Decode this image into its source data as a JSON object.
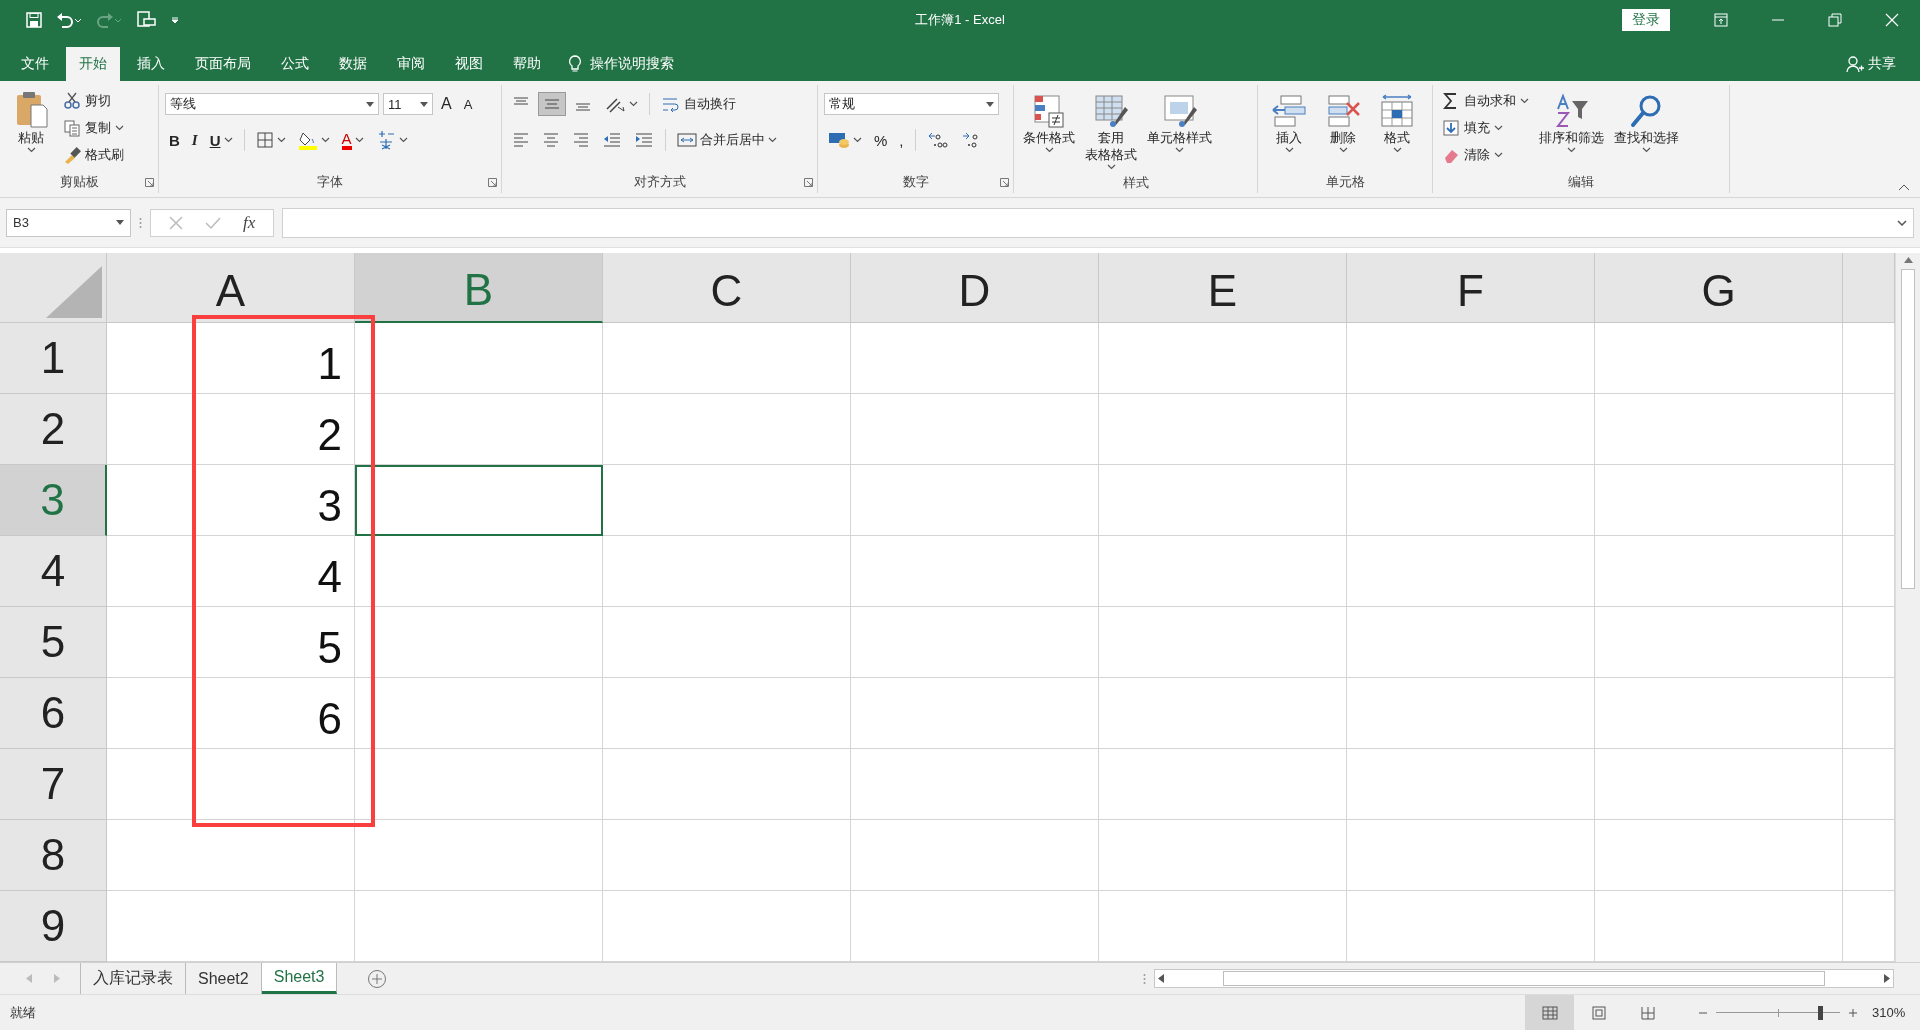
{
  "window": {
    "title": "工作簿1  -  Excel",
    "sign_in": "登录"
  },
  "ribbon_tabs": [
    {
      "label": "文件",
      "selected": false
    },
    {
      "label": "开始",
      "selected": true
    },
    {
      "label": "插入",
      "selected": false
    },
    {
      "label": "页面布局",
      "selected": false
    },
    {
      "label": "公式",
      "selected": false
    },
    {
      "label": "数据",
      "selected": false
    },
    {
      "label": "审阅",
      "selected": false
    },
    {
      "label": "视图",
      "selected": false
    },
    {
      "label": "帮助",
      "selected": false
    }
  ],
  "tell_me": "操作说明搜索",
  "share": "共享",
  "ribbon_groups": [
    {
      "label": "剪贴板",
      "launcher": true,
      "parts": [
        {
          "kind": "large",
          "label": [
            "粘贴"
          ],
          "caret": true
        },
        {
          "kind": "stack",
          "items": [
            {
              "label": "剪切"
            },
            {
              "label": "复制",
              "caret": true
            },
            {
              "label": "格式刷"
            }
          ]
        }
      ]
    },
    {
      "label": "字体",
      "launcher": true,
      "parts": [
        {
          "kind": "lines",
          "lines": [
            {
              "controls": [
                {
                  "kind": "font-combo",
                  "value": "等线"
                },
                {
                  "kind": "size-combo",
                  "value": "11"
                },
                {
                  "kind": "grow",
                  "text": "A"
                },
                {
                  "kind": "shrink",
                  "text": "A"
                }
              ]
            },
            {
              "controls": [
                {
                  "kind": "bold",
                  "text": "B"
                },
                {
                  "kind": "italic",
                  "text": "I"
                },
                {
                  "kind": "underline",
                  "text": "U",
                  "caret": true
                },
                {
                  "kind": "sep"
                },
                {
                  "kind": "borders",
                  "caret": true
                },
                {
                  "kind": "fill-color",
                  "caret": true
                },
                {
                  "kind": "font-color",
                  "text": "A",
                  "caret": true
                },
                {
                  "kind": "phonetic",
                  "caret": true
                }
              ]
            }
          ]
        }
      ]
    },
    {
      "label": "对齐方式",
      "launcher": true,
      "parts": [
        {
          "kind": "lines",
          "lines": [
            {
              "controls": [
                {
                  "kind": "align-top",
                  "selected": false
                },
                {
                  "kind": "align-middle",
                  "selected": true
                },
                {
                  "kind": "align-bottom",
                  "selected": false
                },
                {
                  "kind": "orientation",
                  "caret": true
                },
                {
                  "kind": "sep"
                },
                {
                  "kind": "wrap",
                  "label": "自动换行"
                }
              ]
            },
            {
              "controls": [
                {
                  "kind": "align-left",
                  "selected": false
                },
                {
                  "kind": "align-center",
                  "selected": false
                },
                {
                  "kind": "align-right",
                  "selected": false
                },
                {
                  "kind": "indent-decrease"
                },
                {
                  "kind": "indent-increase"
                },
                {
                  "kind": "sep"
                },
                {
                  "kind": "merge",
                  "label": "合并后居中",
                  "caret": true
                }
              ]
            }
          ]
        }
      ]
    },
    {
      "label": "数字",
      "launcher": true,
      "parts": [
        {
          "kind": "lines",
          "lines": [
            {
              "controls": [
                {
                  "kind": "format-combo",
                  "value": "常规"
                }
              ]
            },
            {
              "controls": [
                {
                  "kind": "currency",
                  "caret": true
                },
                {
                  "kind": "percent",
                  "text": "%"
                },
                {
                  "kind": "comma",
                  "text": ","
                },
                {
                  "kind": "sep"
                },
                {
                  "kind": "decimal-increase"
                },
                {
                  "kind": "decimal-decrease"
                }
              ]
            }
          ]
        }
      ]
    },
    {
      "label": "样式",
      "parts": [
        {
          "kind": "large",
          "label": [
            "条件格式"
          ],
          "caret": true
        },
        {
          "kind": "large",
          "label": [
            "套用",
            "表格格式"
          ],
          "caret": true
        },
        {
          "kind": "large",
          "label": [
            "单元格样式"
          ],
          "caret": true
        }
      ]
    },
    {
      "label": "单元格",
      "parts": [
        {
          "kind": "large",
          "label": [
            "插入"
          ],
          "caret": true
        },
        {
          "kind": "large",
          "label": [
            "删除"
          ],
          "caret": true
        },
        {
          "kind": "large",
          "label": [
            "格式"
          ],
          "caret": true
        }
      ]
    },
    {
      "label": "编辑",
      "parts": [
        {
          "kind": "stack",
          "items": [
            {
              "label": "自动求和",
              "caret": true
            },
            {
              "label": "填充",
              "caret": true
            },
            {
              "label": "清除",
              "caret": true
            }
          ]
        },
        {
          "kind": "large",
          "label": [
            "排序和筛选"
          ],
          "caret": true
        },
        {
          "kind": "large",
          "label": [
            "查找和选择"
          ],
          "caret": true
        }
      ]
    }
  ],
  "formula_bar": {
    "name_box": "B3",
    "fx": "fx"
  },
  "sheet": {
    "columns": [
      {
        "label": "A",
        "selected": false
      },
      {
        "label": "B",
        "selected": true
      },
      {
        "label": "C",
        "selected": false
      },
      {
        "label": "D",
        "selected": false
      },
      {
        "label": "E",
        "selected": false
      },
      {
        "label": "F",
        "selected": false
      },
      {
        "label": "G",
        "selected": false
      }
    ],
    "rows": [
      {
        "label": "1",
        "selected": false,
        "values": [
          "1"
        ]
      },
      {
        "label": "2",
        "selected": false,
        "values": [
          "2"
        ]
      },
      {
        "label": "3",
        "selected": true,
        "values": [
          "3"
        ]
      },
      {
        "label": "4",
        "selected": false,
        "values": [
          "4"
        ]
      },
      {
        "label": "5",
        "selected": false,
        "values": [
          "5"
        ]
      },
      {
        "label": "6",
        "selected": false,
        "values": [
          "6"
        ]
      },
      {
        "label": "7",
        "selected": false
      },
      {
        "label": "8",
        "selected": false
      },
      {
        "label": "9",
        "selected": false
      }
    ],
    "highlight_frame": true
  },
  "sheet_tabs": [
    {
      "label": "入库记录表",
      "selected": false
    },
    {
      "label": "Sheet2",
      "selected": false
    },
    {
      "label": "Sheet3",
      "selected": true
    }
  ],
  "status_bar": {
    "status": "就绪",
    "views": [
      {
        "kind": "normal",
        "selected": true
      },
      {
        "kind": "page-layout",
        "selected": false
      },
      {
        "kind": "page-break",
        "selected": false
      }
    ],
    "zoom": {
      "level": 0.84,
      "label": "310%"
    }
  }
}
